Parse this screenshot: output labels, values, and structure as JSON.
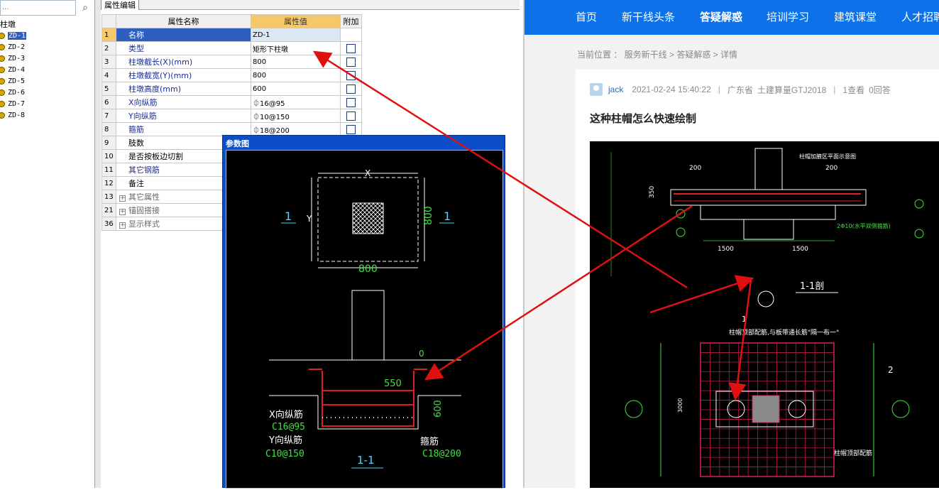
{
  "tree": {
    "search_placeholder": "...",
    "root_label": "柱墩",
    "items": [
      {
        "label": "ZD-1",
        "selected": true
      },
      {
        "label": "ZD-2"
      },
      {
        "label": "ZD-3"
      },
      {
        "label": "ZD-4"
      },
      {
        "label": "ZD-5"
      },
      {
        "label": "ZD-6"
      },
      {
        "label": "ZD-7"
      },
      {
        "label": "ZD-8"
      }
    ]
  },
  "property_editor": {
    "tab_label": "属性编辑",
    "columns": {
      "name": "属性名称",
      "value": "属性值",
      "extra": "附加"
    },
    "rows": [
      {
        "num": "1",
        "name": "名称",
        "value": "ZD-1"
      },
      {
        "num": "2",
        "name": "类型",
        "value": "矩形下柱墩"
      },
      {
        "num": "3",
        "name": "柱墩截长(X)(mm)",
        "value": "800"
      },
      {
        "num": "4",
        "name": "柱墩截宽(Y)(mm)",
        "value": "800"
      },
      {
        "num": "5",
        "name": "柱墩高度(mm)",
        "value": "600"
      },
      {
        "num": "6",
        "name": "X向纵筋",
        "value": "⏀16@95"
      },
      {
        "num": "7",
        "name": "Y向纵筋",
        "value": "⏀10@150"
      },
      {
        "num": "8",
        "name": "箍筋",
        "value": "⏀18@200"
      },
      {
        "num": "9",
        "name": "肢数",
        "value": ""
      },
      {
        "num": "10",
        "name": "是否按板边切割",
        "value": ""
      },
      {
        "num": "11",
        "name": "其它钢筋",
        "value": ""
      },
      {
        "num": "12",
        "name": "备注",
        "value": ""
      },
      {
        "num": "13",
        "name": "其它属性",
        "value": ""
      },
      {
        "num": "21",
        "name": "锚固搭接",
        "value": ""
      },
      {
        "num": "36",
        "name": "显示样式",
        "value": ""
      }
    ]
  },
  "param_window": {
    "title": "参数图",
    "plan": {
      "x_label": "X",
      "y_label": "Y",
      "x_value": "800",
      "y_value": "800",
      "section_mark": "1"
    },
    "section": {
      "zero": "0",
      "height_550": "550",
      "height_600": "600",
      "x_bar_label": "X向纵筋",
      "x_bar_value": "C16@95",
      "y_bar_label": "Y向纵筋",
      "y_bar_value": "C10@150",
      "stirrup_label": "箍筋",
      "stirrup_value": "C18@200",
      "section_title": "1-1"
    }
  },
  "website": {
    "nav": [
      "首页",
      "新干线头条",
      "答疑解惑",
      "培训学习",
      "建筑课堂",
      "人才招聘"
    ],
    "nav_active": "答疑解惑",
    "breadcrumb": "当前位置 ： 服务新干线 > 答疑解惑 > 详情",
    "question": {
      "user": "jack",
      "date": "2021-02-24 15:40:22",
      "location": "广东省",
      "software": "土建算量GTJ2018",
      "views": "1查看",
      "answers": "0回答",
      "title": "这种柱帽怎么快速绘制"
    },
    "drawing_text": {
      "section_title": "1-1剖",
      "dim_200": "200",
      "dim_1500": "1500",
      "dim_350": "350",
      "note_rebar": "柱帽顶部配筋,与板带通长筋\"隔一布一\"",
      "note_bottom": "柱帽顶部配筋",
      "dim_3000": "3000",
      "mark_2": "2",
      "mark_1": "1",
      "top_note": "柱帽加腋区平面示意图",
      "side_note": "2Φ10(水平双侧箍筋)"
    }
  },
  "colors": {
    "nav_blue": "#0d72e9",
    "select_blue": "#2e5fbf",
    "header_orange": "#f5c96b",
    "window_blue": "#0c4ec7",
    "arrow_red": "#e01010"
  }
}
